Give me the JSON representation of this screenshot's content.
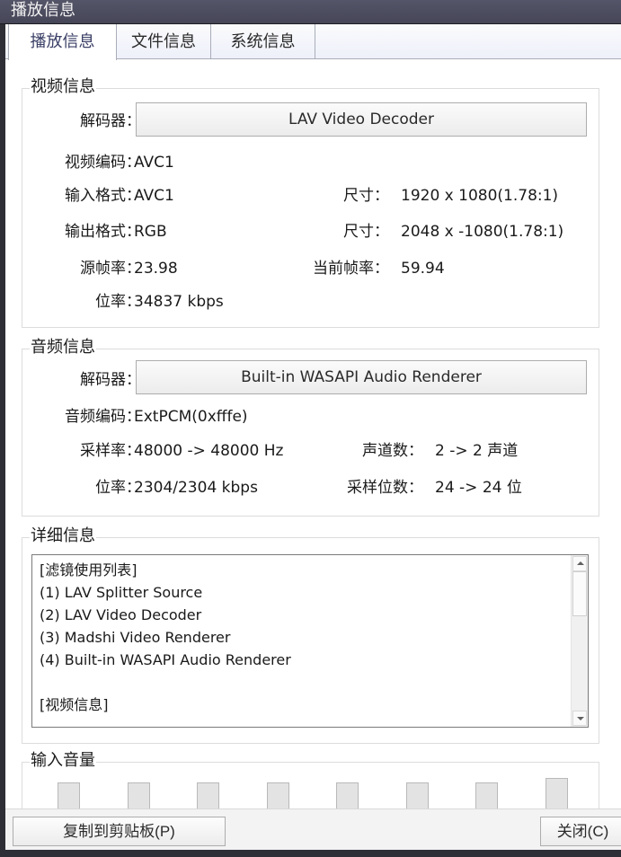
{
  "window": {
    "title": "播放信息"
  },
  "tabs": [
    {
      "label": "播放信息",
      "active": true
    },
    {
      "label": "文件信息",
      "active": false
    },
    {
      "label": "系统信息",
      "active": false
    }
  ],
  "video": {
    "group_title": "视频信息",
    "decoder_label": "解码器：",
    "decoder_value": "LAV Video Decoder",
    "codec_label": "视频编码：",
    "codec_value": "AVC1",
    "input_format_label": "输入格式：",
    "input_format_value": "AVC1",
    "input_size_label": "尺寸：",
    "input_size_value": "1920 x 1080(1.78:1)",
    "output_format_label": "输出格式：",
    "output_format_value": "RGB",
    "output_size_label": "尺寸：",
    "output_size_value": "2048 x -1080(1.78:1)",
    "source_fps_label": "源帧率：",
    "source_fps_value": "23.98",
    "current_fps_label": "当前帧率：",
    "current_fps_value": "59.94",
    "bitrate_label": "位率：",
    "bitrate_value": "34837 kbps"
  },
  "audio": {
    "group_title": "音频信息",
    "decoder_label": "解码器：",
    "decoder_value": "Built-in WASAPI Audio Renderer",
    "codec_label": "音频编码：",
    "codec_value": "ExtPCM(0xfffe)",
    "sample_rate_label": "采样率：",
    "sample_rate_value": "48000 -> 48000 Hz",
    "channels_label": "声道数：",
    "channels_value": "2 -> 2 声道",
    "bitrate_label": "位率：",
    "bitrate_value": "2304/2304 kbps",
    "bit_depth_label": "采样位数：",
    "bit_depth_value": "24 -> 24 位"
  },
  "detail": {
    "group_title": "详细信息",
    "lines": [
      "[滤镜使用列表]",
      "(1) LAV Splitter Source",
      "(2) LAV Video Decoder",
      "(3) Madshi Video Renderer",
      "(4) Built-in WASAPI Audio Renderer",
      "",
      "[视频信息]"
    ]
  },
  "volume": {
    "group_title": "输入音量",
    "levels": [
      0.3,
      0.3,
      0.3,
      0.3,
      0.3,
      0.3,
      0.3,
      0.35
    ]
  },
  "footer": {
    "copy_label": "复制到剪贴板(P)",
    "close_label": "关闭(C)"
  }
}
